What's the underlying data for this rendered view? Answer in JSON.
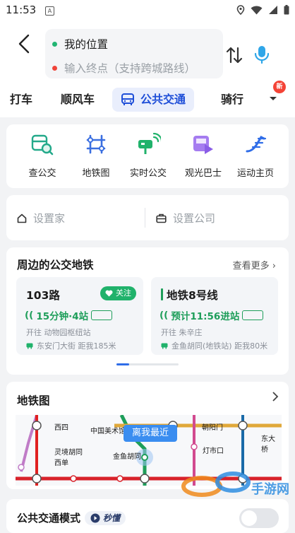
{
  "status_bar": {
    "time": "11:53",
    "sim_label": "A"
  },
  "route": {
    "origin": "我的位置",
    "destination_placeholder": "输入终点（支持跨城路线）",
    "origin_color": "#22b573",
    "destination_color": "#f0443a"
  },
  "tabs": [
    {
      "label": "打车"
    },
    {
      "label": "顺风车"
    },
    {
      "label": "公共交通",
      "active": true
    },
    {
      "label": "骑行"
    }
  ],
  "tabs_badge": "新",
  "quick_actions": [
    {
      "label": "查公交",
      "icon": "bus-search-icon"
    },
    {
      "label": "地铁图",
      "icon": "metro-map-icon"
    },
    {
      "label": "实时公交",
      "icon": "realtime-bus-icon"
    },
    {
      "label": "观光巴士",
      "icon": "sightseeing-bus-icon"
    },
    {
      "label": "运动主页",
      "icon": "sports-home-icon"
    }
  ],
  "address": {
    "home": "设置家",
    "company": "设置公司"
  },
  "nearby": {
    "title": "周边的公交地铁",
    "more": "查看更多",
    "cards": [
      {
        "name": "103路",
        "follow": "关注",
        "eta": "15分钟·4站",
        "direction": "开往 动物园枢纽站",
        "stop": "东安门大街 距我185米"
      },
      {
        "name": "地铁8号线",
        "eta": "预计11:56进站",
        "direction": "开往 朱辛庄",
        "stop": "金鱼胡同(地铁站) 距我80米"
      }
    ]
  },
  "metro": {
    "title": "地铁图",
    "nearest_label": "离我最近",
    "stations": [
      "西四",
      "中国美术馆",
      "朝阳门",
      "东大桥",
      "灵境胡同",
      "西单",
      "金鱼胡同",
      "灯市口"
    ]
  },
  "mode": {
    "title": "公共交通模式",
    "tag": "秒懂"
  },
  "watermark": {
    "text": "手游网"
  },
  "colors": {
    "accent": "#2f6de8",
    "green": "#20b26b",
    "tab_active_bg": "#e9eefc"
  }
}
